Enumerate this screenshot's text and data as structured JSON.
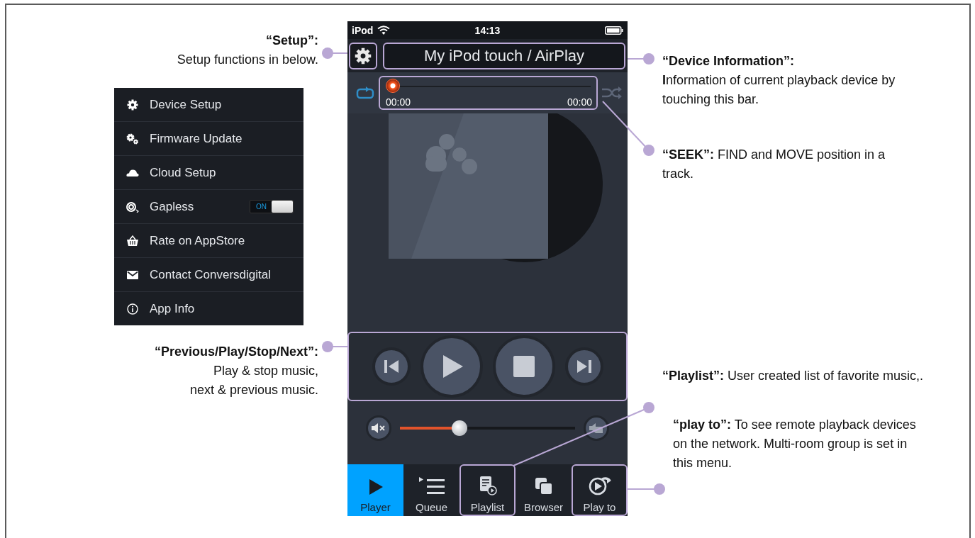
{
  "left_callouts": [
    {
      "text": "**“Setup”:**\nSetup functions in below."
    },
    {
      "text": "**“Previous/Play/Stop/Next”:**\nPlay & stop music,\nnext & previous music."
    }
  ],
  "setup_menu": {
    "items": [
      {
        "label": "Device Setup",
        "kind": "link"
      },
      {
        "label": "Firmware Update",
        "kind": "link"
      },
      {
        "label": "Cloud Setup",
        "kind": "link"
      },
      {
        "label": "Gapless",
        "kind": "toggle",
        "on": true,
        "toggle_label": "ON"
      },
      {
        "label": "Rate on AppStore",
        "kind": "link"
      },
      {
        "label": "Contact Conversdigital",
        "kind": "link"
      },
      {
        "label": "App Info",
        "kind": "link"
      }
    ]
  },
  "phone": {
    "status_bar": {
      "carrier": "iPod",
      "time": "14:13"
    },
    "device_button": "My iPod touch / AirPlay",
    "seek": {
      "level": 0,
      "elapsed": "00:00",
      "total": "00:00"
    },
    "volume": {
      "level": 0.34
    },
    "tabs": [
      {
        "label": "Player",
        "selected": true,
        "highlighted": false
      },
      {
        "label": "Queue",
        "selected": false,
        "highlighted": false
      },
      {
        "label": "Playlist",
        "selected": false,
        "highlighted": true
      },
      {
        "label": "Browser",
        "selected": false,
        "highlighted": false
      },
      {
        "label": "Play to",
        "selected": false,
        "highlighted": true
      }
    ]
  },
  "right_callouts": [
    {
      "text": "**“Device Information”:**\n**I**nformation of current playback device by touching this bar."
    },
    {
      "text": "**“SEEK”:**  FIND and MOVE position in a track."
    },
    {
      "text": "**“Playlist”:**  User created list of favorite music,."
    },
    {
      "text": "**“play to”:**  To see remote playback devices on the network. Multi-room group is set in this menu."
    }
  ]
}
